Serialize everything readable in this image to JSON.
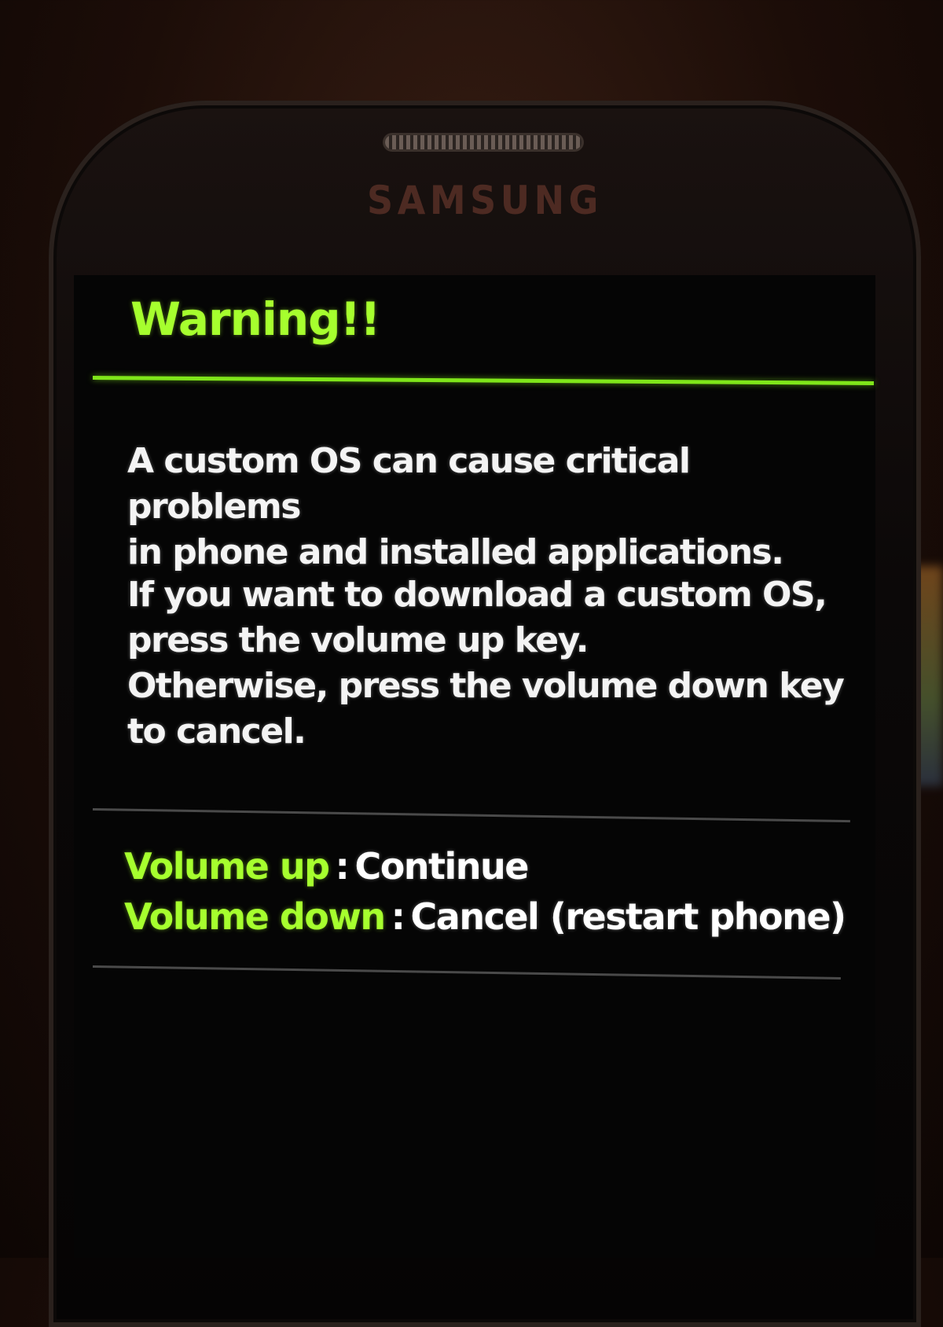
{
  "device": {
    "brand": "SAMSUNG"
  },
  "warning": {
    "title": "Warning!!",
    "paragraph_1": "A custom OS can cause critical problems\nin phone and installed applications.",
    "paragraph_2": "If you want to download a custom OS,\npress the volume up key.\nOtherwise, press the volume down key\nto cancel."
  },
  "keys": [
    {
      "name": "Volume up",
      "separator": ":",
      "action": "Continue"
    },
    {
      "name": "Volume down",
      "separator": ":",
      "action": "Cancel (restart phone)"
    }
  ],
  "colors": {
    "accent_green": "#a6ff2e",
    "text_white": "#f4f4f4",
    "screen_background": "#050505"
  }
}
